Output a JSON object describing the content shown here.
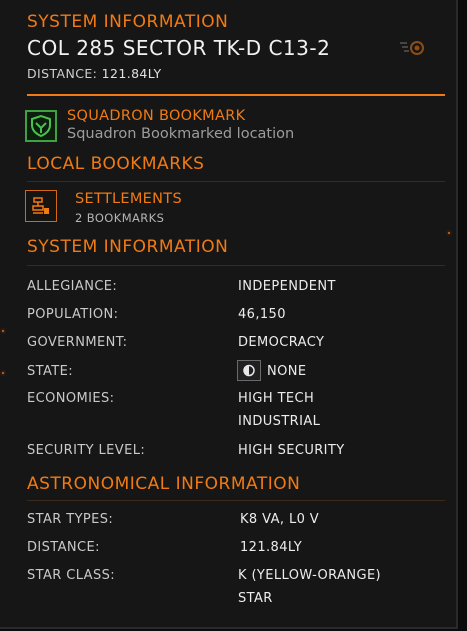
{
  "header": {
    "section_title": "SYSTEM INFORMATION",
    "system_name": "COL 285 SECTOR TK-D C13-2",
    "distance_label": "DISTANCE:",
    "distance_value": "121.84LY"
  },
  "squadron_bookmark": {
    "title": "SQUADRON BOOKMARK",
    "subtitle": "Squadron Bookmarked location",
    "icon": "squadron-bookmark-icon"
  },
  "local_bookmarks": {
    "title": "LOCAL BOOKMARKS",
    "items": [
      {
        "title": "SETTLEMENTS",
        "subtitle": "2 BOOKMARKS",
        "icon": "settlement-icon"
      }
    ]
  },
  "system_information": {
    "title": "SYSTEM INFORMATION",
    "rows": [
      {
        "label": "ALLEGIANCE:",
        "value": "INDEPENDENT"
      },
      {
        "label": "POPULATION:",
        "value": "46,150"
      },
      {
        "label": "GOVERNMENT:",
        "value": "DEMOCRACY"
      },
      {
        "label": "STATE:",
        "value": "NONE",
        "icon": "state-none-icon"
      },
      {
        "label": "ECONOMIES:",
        "value": "HIGH TECH",
        "value2": "INDUSTRIAL"
      },
      {
        "label": "SECURITY LEVEL:",
        "value": "HIGH SECURITY"
      }
    ]
  },
  "astronomical_information": {
    "title": "ASTRONOMICAL INFORMATION",
    "rows": [
      {
        "label": "STAR TYPES:",
        "value": "K8 VA, L0 V"
      },
      {
        "label": "DISTANCE:",
        "value": "121.84LY"
      },
      {
        "label": "STAR CLASS:",
        "value": "K (YELLOW-ORANGE)",
        "value2": "STAR"
      }
    ]
  },
  "colors": {
    "accent": "#f07b14",
    "squadron_green": "#3da23f",
    "panel_bg": "#161617",
    "text": "#ececec"
  }
}
